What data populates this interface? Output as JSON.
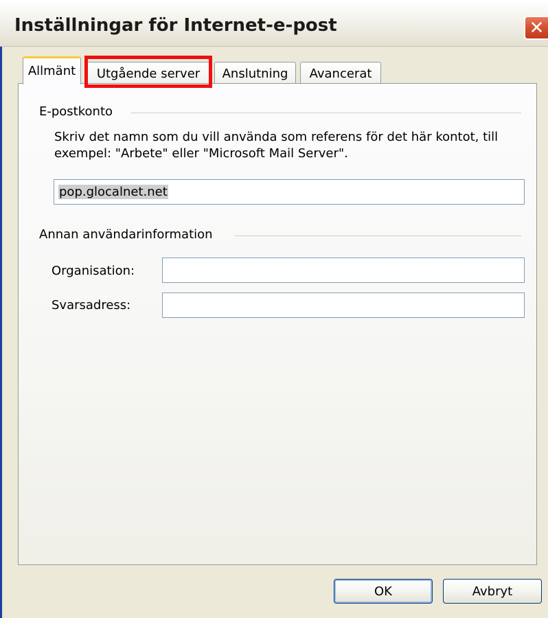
{
  "dialog": {
    "title": "Inställningar för Internet-e-post",
    "close_glyph": "✕"
  },
  "tabs": [
    {
      "label": "Allmänt",
      "active": true
    },
    {
      "label": "Utgående server",
      "active": false,
      "highlighted": true
    },
    {
      "label": "Anslutning",
      "active": false
    },
    {
      "label": "Avancerat",
      "active": false
    }
  ],
  "account_group": {
    "title": "E-postkonto",
    "description": "Skriv det namn som du vill använda som referens för det här kontot, till exempel: \"Arbete\" eller \"Microsoft Mail Server\".",
    "account_name_value": "pop.glocalnet.net"
  },
  "user_info_group": {
    "title": "Annan användarinformation",
    "organisation_label": "Organisation:",
    "organisation_value": "",
    "reply_address_label": "Svarsadress:",
    "reply_address_value": ""
  },
  "buttons": {
    "ok": "OK",
    "cancel": "Avbryt"
  },
  "colors": {
    "highlight": "#ee1111",
    "active_tab_accent": "#ffc83c",
    "close_button": "#d2502f"
  }
}
